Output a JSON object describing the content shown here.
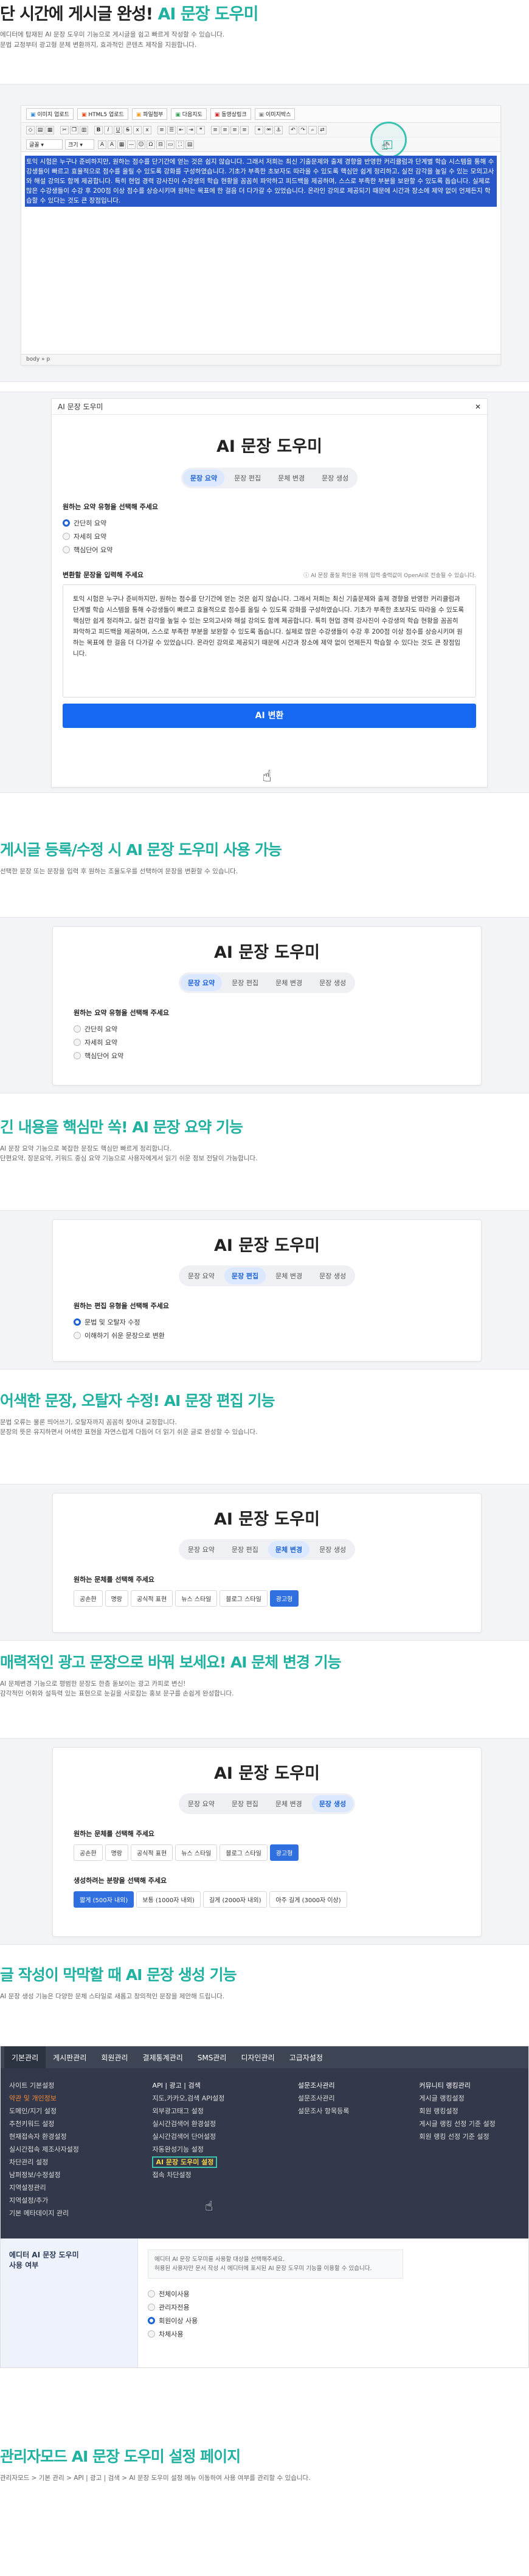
{
  "intro": {
    "title_prefix": "단 시간에 게시글 완성! ",
    "title_accent": "AI 문장 도우미",
    "desc_line1": "에디터에 탑재된 AI 문장 도우미 기능으로 게시글을 쉽고 빠르게 작성할 수 있습니다.",
    "desc_line2": "문법 교정부터 광고형 문체 변환까지, 효과적인 콘텐츠 제작을 지원합니다."
  },
  "editor": {
    "upload_buttons": [
      "이미지 업로드",
      "HTML5 업로드",
      "파일첨부",
      "다음지도",
      "동영상링크",
      "이미지박스"
    ],
    "format_select": "글꼴",
    "size_select": "크기",
    "body_text": "토익 시험은 누구나 준비하지만, 원하는 점수를 단기간에 얻는 것은 쉽지 않습니다. 그래서 저희는 최신 기출문제와 출제 경향을 반영한 커리큘럼과 단계별 학습 시스템을 통해 수강생들이 빠르고 효율적으로 점수를 올릴 수 있도록 강화를 구성하였습니다. 기초가 부족한 초보자도 따라올 수 있도록 핵심만 쉽게 정리하고, 실전 감각을 높일 수 있는 모의고사와 해설 강의도 함께 제공합니다. 특히 현업 경력 강사진이 수강생의 학습 현황을 꼼꼼히 파악하고 피드백을 제공하며, 스스로 부족한 부분을 보완할 수 있도록 돕습니다. 실제로 많은 수강생들이 수강 후 200점 이상 점수를 상승시키며 원하는 목표에 한 걸음 더 다가갈 수 있었습니다. 온라인 강의로 제공되기 때문에 시간과 장소에 제약 없이 언제든지 학습할 수 있다는 것도 큰 장점입니다.",
    "status_left": "body",
    "status_right": "p"
  },
  "dialog": {
    "window_title": "AI 문장 도우미",
    "close": "✕",
    "title": "AI 문장 도우미",
    "tabs": [
      "문장 요약",
      "문장 편집",
      "문체 변경",
      "문장 생성"
    ],
    "summary_label": "원하는 요약 유형을 선택해 주세요",
    "summary_options": [
      "간단히 요약",
      "자세히 요약",
      "핵심단어 요약"
    ],
    "input_label": "변환할 문장을 입력해 주세요",
    "notice": "AI 문장 품질 확인을 위해 입력·출력값이 OpenAI로 전송될 수 있습니다.",
    "textarea": "토익 시험은 누구나 준비하지만, 원하는 점수를 단기간에 얻는 것은 쉽지 않습니다. 그래서 저희는 최신 기출문제와 출제 경향을 반영한 커리큘럼과 단계별 학습 시스템을 통해 수강생들이 빠르고 효율적으로 점수를 올릴 수 있도록 강화를 구성하였습니다. 기초가 부족한 초보자도 따라올 수 있도록 핵심만 쉽게 정리하고, 실전 감각을 높일 수 있는 모의고사와 해설 강의도 함께 제공합니다. 특히 현업 경력 강사진이 수강생의 학습 현황을 꼼꼼히 파악하고 피드백을 제공하며, 스스로 부족한 부분을 보완할 수 있도록 돕습니다. 실제로 많은 수강생들이 수강 후 200점 이상 점수를 상승시키며 원하는 목표에 한 걸음 더 다가갈 수 있었습니다. 온라인 강의로 제공되기 때문에 시간과 장소에 제약 없이 언제든지 학습할 수 있다는 것도 큰 장점입니다.",
    "convert_button": "AI 변환"
  },
  "sec_use": {
    "title": "게시글 등록/수정 시 AI 문장 도우미 사용 가능",
    "desc": "선택한 문장 또는 문장을 입력 후 원하는 조율도우를 선택하여 문장을 변환할 수 있습니다."
  },
  "card_summary": {
    "title": "AI 문장 도우미",
    "tabs": [
      "문장 요약",
      "문장 편집",
      "문체 변경",
      "문장 생성"
    ],
    "label": "원하는 요약 유형을 선택해 주세요",
    "options": [
      "간단히 요약",
      "자세히 요약",
      "핵심단어 요약"
    ]
  },
  "sec_summary": {
    "title": "긴 내용을 핵심만 쏙! AI 문장 요약 기능",
    "desc_line1": "AI 문장 요약 기능으로 복잡한 문장도 핵심만 빠르게 정리합니다.",
    "desc_line2": "단편요약, 장문요약, 키워드 중심 요약 기능으로 사용자에게서 읽기 쉬운 정보 전달이 가능합니다."
  },
  "card_edit": {
    "title": "AI 문장 도우미",
    "tabs": [
      "문장 요약",
      "문장 편집",
      "문체 변경",
      "문장 생성"
    ],
    "label": "원하는 편집 유형을 선택해 주세요",
    "options": [
      "문법 및 오탈자 수정",
      "이해하기 쉬운 문장으로 변환"
    ]
  },
  "sec_edit": {
    "title": "어색한 문장, 오탈자 수정! AI 문장 편집 기능",
    "desc_line1": "문법 오류는 물론 띄어쓰기, 오탈자까지 꼼꼼히 찾아내 교정합니다.",
    "desc_line2": "문장의 뜻은 유지하면서 어색한 표현을 자연스럽게 다듬어 더 읽기 쉬운 글로 완성할 수 있습니다."
  },
  "card_style": {
    "title": "AI 문장 도우미",
    "tabs": [
      "문장 요약",
      "문장 편집",
      "문체 변경",
      "문장 생성"
    ],
    "label": "원하는 문체를 선택해 주세요",
    "chips": [
      "공손한",
      "명랑",
      "공식적 표현",
      "뉴스 스타일",
      "블로그 스타일",
      "광고형"
    ]
  },
  "sec_style": {
    "title": "매력적인 광고 문장으로 바꿔 보세요! AI 문체 변경 기능",
    "desc_line1": "AI 문체변경 기능으로 평범한 문장도 한층 돋보이는 광고 카피로 변신!",
    "desc_line2": "감각적인 어휘와 설득력 있는 표현으로 눈길을 사로잡는 홍보 문구를 손쉽게 완성합니다."
  },
  "card_generate": {
    "title": "AI 문장 도우미",
    "tabs": [
      "문장 요약",
      "문장 편집",
      "문체 변경",
      "문장 생성"
    ],
    "label": "원하는 문체를 선택해 주세요",
    "chips": [
      "공손한",
      "명랑",
      "공식적 표현",
      "뉴스 스타일",
      "블로그 스타일",
      "광고형"
    ],
    "length_label": "생성하려는 분량을 선택해 주세요",
    "length_chips": [
      "짧게 (500자 내외)",
      "보통 (1000자 내외)",
      "길게 (2000자 내외)",
      "아주 길게 (3000자 이상)"
    ]
  },
  "sec_generate": {
    "title": "글 작성이 막막할 때 AI 문장 생성 기능",
    "desc": "AI 문장 생성 기능은 다양한 문체 스타일로 새롭고 창의적인 문장을 제안해 드립니다."
  },
  "admin": {
    "nav": [
      "기본관리",
      "게시판관리",
      "회원관리",
      "결제통계관리",
      "SMS관리",
      "디자인관리",
      "고급자설정"
    ],
    "col1": [
      "사이트 기본설정",
      "약관 및 개인정보",
      "도메인/지기 설정",
      "추천키워드 설정",
      "현재접속자 환경설정",
      "실시간접속 제조사자설정",
      "차단관리 설정",
      "남퍼정보/수정설정",
      "지역설정관리",
      "지역설정/추가",
      "기본 메타데이지 관리"
    ],
    "col1_active": 1,
    "col2": [
      "API | 광고 | 검색",
      "지도,카카오,검색 API설정",
      "외부광고태그 설정",
      "실시간검색어 환경설정",
      "실시간검색어 단어설정",
      "자동완성기능 설정",
      "AI 문장 도우미 설정",
      "접속 차단설정"
    ],
    "col2_highlight": 6,
    "col3": [
      "설문조사관리",
      "설문조사관리",
      "설문조사 항목등록"
    ],
    "col4": [
      "커뮤니티 랭킹관리",
      "게시글 랭킹설정",
      "회원 랭킹설정",
      "게시글 랭킹 선정 기준 설정",
      "회원 랭킹 선정 기준 설정"
    ],
    "setting_label": "에디터 AI 문장 도우미\n사용 여부",
    "setting_desc_line1": "에디터 AI 문장 도우미를 사용할 대상을 선택해주세요.",
    "setting_desc_line2": "허용된 사용자만 문서 작성 시 에디터에 표시된 AI 문장 도우미 기능을 이용할 수 있습니다.",
    "setting_options": [
      "전체이사용",
      "관리자전용",
      "회원이상 사용",
      "차체사용"
    ],
    "setting_selected": 2
  },
  "sec_admin": {
    "title": "관리자모드 AI 문장 도우미 설정 페이지",
    "desc": "관리자모드 > 기본 관리 > API | 광고 | 검색 > AI 문장 도우미 설정 메뉴 이동하여 사용 여부를 관리할 수 있습니다."
  }
}
